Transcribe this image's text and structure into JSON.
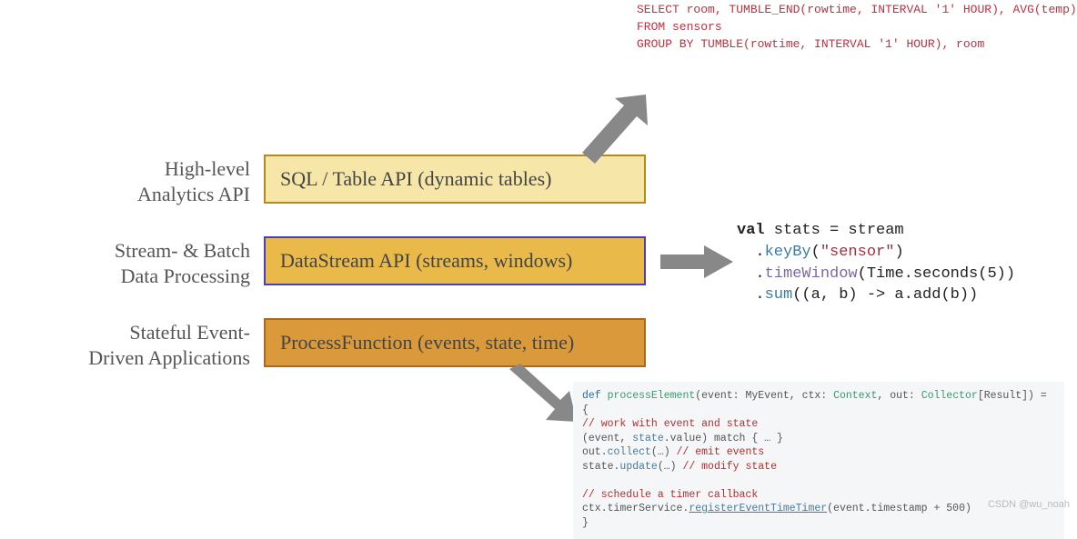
{
  "labels": {
    "l1a": "High-level",
    "l1b": "Analytics API",
    "l2a": "Stream- & Batch",
    "l2b": "Data Processing",
    "l3a": "Stateful Event-",
    "l3b": "Driven Applications"
  },
  "boxes": {
    "b1": "SQL / Table API (dynamic tables)",
    "b2": "DataStream API (streams, windows)",
    "b3": "ProcessFunction (events, state, time)"
  },
  "sql": {
    "line1": "SELECT room, TUMBLE_END(rowtime, INTERVAL '1' HOUR), AVG(temp)",
    "line2": "FROM sensors",
    "line3": "GROUP BY TUMBLE(rowtime, INTERVAL '1' HOUR), room"
  },
  "scala": {
    "kw_val": "val",
    "t0": " stats = stream",
    "indent": "  .",
    "m_keyBy": "keyBy",
    "p_keyBy_open": "(",
    "str_sensor": "\"sensor\"",
    "p_close": ")",
    "m_timeWindow": "timeWindow",
    "p_tw": "(Time.seconds(5))",
    "m_sum": "sum",
    "p_sum": "((a, b) -> a.add(b))"
  },
  "proc": {
    "def": "def",
    "fn": "processElement",
    "sig1": "(event: MyEvent, ctx: ",
    "ctxType": "Context",
    "sig2": ", out: ",
    "colType": "Collector",
    "sig3": "[Result]) = {",
    "c1": "// work with event and state",
    "l2a": "  (event, ",
    "l2b": "state",
    "l2c": ".value) match { … }",
    "blank": "",
    "l3a": "  out.",
    "l3b": "collect",
    "l3c": "(…) ",
    "c2": "// emit events",
    "l4a": "  state.",
    "l4b": "update",
    "l4c": "(…) ",
    "c3": "// modify state",
    "c4": "// schedule a timer callback",
    "l6a": "  ctx.timerService.",
    "l6b": "registerEventTimeTimer",
    "l6c": "(event.timestamp + 500)",
    "close": "}"
  },
  "watermark": "CSDN @wu_noah"
}
